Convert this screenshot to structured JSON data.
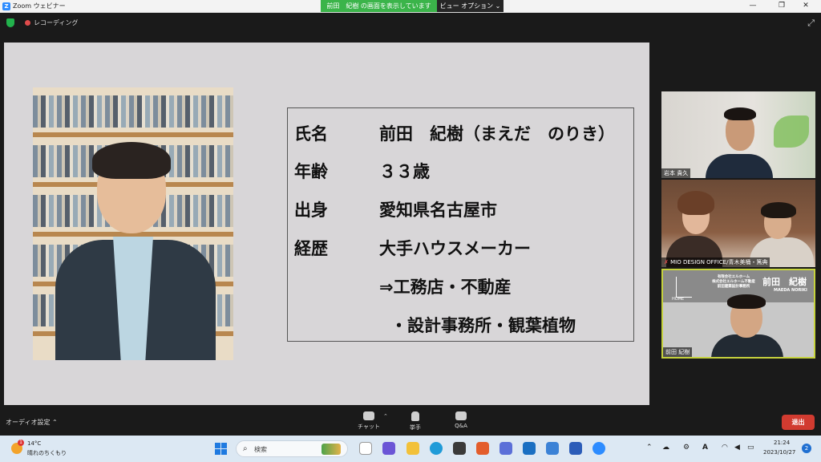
{
  "window": {
    "app_title": "Zoom ウェビナー",
    "share_banner": "前田　紀樹 の画面を表示しています",
    "view_options": "ビュー オプション ⌄",
    "minimize": "—",
    "maximize": "❐",
    "close": "✕"
  },
  "meeting": {
    "recording_label": "レコーディング"
  },
  "slide": {
    "rows": [
      {
        "key": "氏名",
        "value": "前田　紀樹（まえだ　のりき）"
      },
      {
        "key": "年齢",
        "value": "３３歳"
      },
      {
        "key": "出身",
        "value": "愛知県名古屋市"
      },
      {
        "key": "経歴",
        "value": "大手ハウスメーカー"
      },
      {
        "key": "",
        "value": "⇒工務店・不動産"
      },
      {
        "key": "",
        "value": "・設計事務所・観葉植物"
      }
    ]
  },
  "participants": [
    {
      "name": "岩本 貴久"
    },
    {
      "name": "MIO DESIGN OFFICE/青木美桶・篤典"
    },
    {
      "name": "前田 紀樹"
    }
  ],
  "tile3_overlay": {
    "logo_text": "HOME",
    "company_line1": "有限会社エルホーム",
    "company_line2": "株式会社エルホーム不動産",
    "company_line3": "前田建築設計事務所",
    "big_name": "前田　紀樹",
    "roman_name": "MAEDA NORIKI"
  },
  "toolbar": {
    "audio_settings": "オーディオ設定 ⌃",
    "chat": "チャット",
    "raise_hand": "挙手",
    "qa": "Q&A",
    "leave": "退出"
  },
  "taskbar": {
    "weather_temp": "14°C",
    "weather_desc": "晴れのちくもり",
    "weather_badge": "1",
    "search_placeholder": "検索",
    "time": "21:24",
    "date": "2023/10/27",
    "notification_count": "2",
    "ime": "A"
  },
  "colors": {
    "share_banner": "#3bb44a",
    "leave_button": "#d13b30",
    "active_speaker_border": "#c6d33e"
  }
}
